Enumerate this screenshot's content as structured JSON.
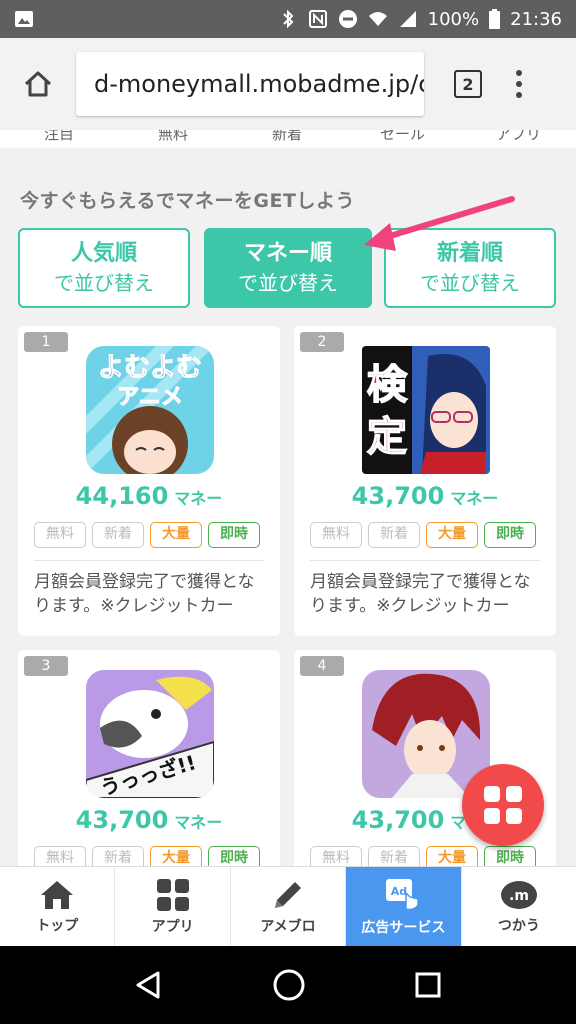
{
  "status_bar": {
    "battery": "100%",
    "time": "21:36"
  },
  "browser": {
    "url": "d-moneymall.mobadme.jp/c",
    "tab_count": "2"
  },
  "categories": [
    "注目",
    "無料",
    "新着",
    "セール",
    "アプリ"
  ],
  "lead": "今すぐもらえるでマネーをGETしよう",
  "sort_buttons": [
    {
      "title": "人気順",
      "sub": "で並び替え"
    },
    {
      "title": "マネー順",
      "sub": "で並び替え"
    },
    {
      "title": "新着順",
      "sub": "で並び替え"
    }
  ],
  "cards": [
    {
      "rank": "1",
      "icon_text_1": "よむよむ",
      "icon_text_2": "アニメ",
      "money": "44,160",
      "unit": "マネー",
      "desc": "月額会員登録完了で獲得となります。※クレジットカード…"
    },
    {
      "rank": "2",
      "icon_text_1": "検",
      "icon_text_2": "定",
      "money": "43,700",
      "unit": "マネー",
      "desc": "月額会員登録完了で獲得となります。※クレジットカード…"
    },
    {
      "rank": "3",
      "icon_text_1": "うっっざ!!",
      "money": "43,700",
      "unit": "マネー",
      "desc": ""
    },
    {
      "rank": "4",
      "money": "43,700",
      "unit": "マネー",
      "desc": ""
    }
  ],
  "tags": {
    "free": "無料",
    "new": "新着",
    "big": "大量",
    "now": "即時"
  },
  "bottom_nav": [
    {
      "label": "トップ",
      "icon": "house-icon"
    },
    {
      "label": "アプリ",
      "icon": "grid-icon"
    },
    {
      "label": "アメブロ",
      "icon": "pencil-icon"
    },
    {
      "label": "広告サービス",
      "icon": "ad-click-icon"
    },
    {
      "label": "つかう",
      "icon": "m-coin-icon"
    }
  ],
  "colors": {
    "accent": "#3cc7a8",
    "fab": "#f24a4a",
    "nav_active": "#4a97f0",
    "arrow": "#f0437e"
  }
}
